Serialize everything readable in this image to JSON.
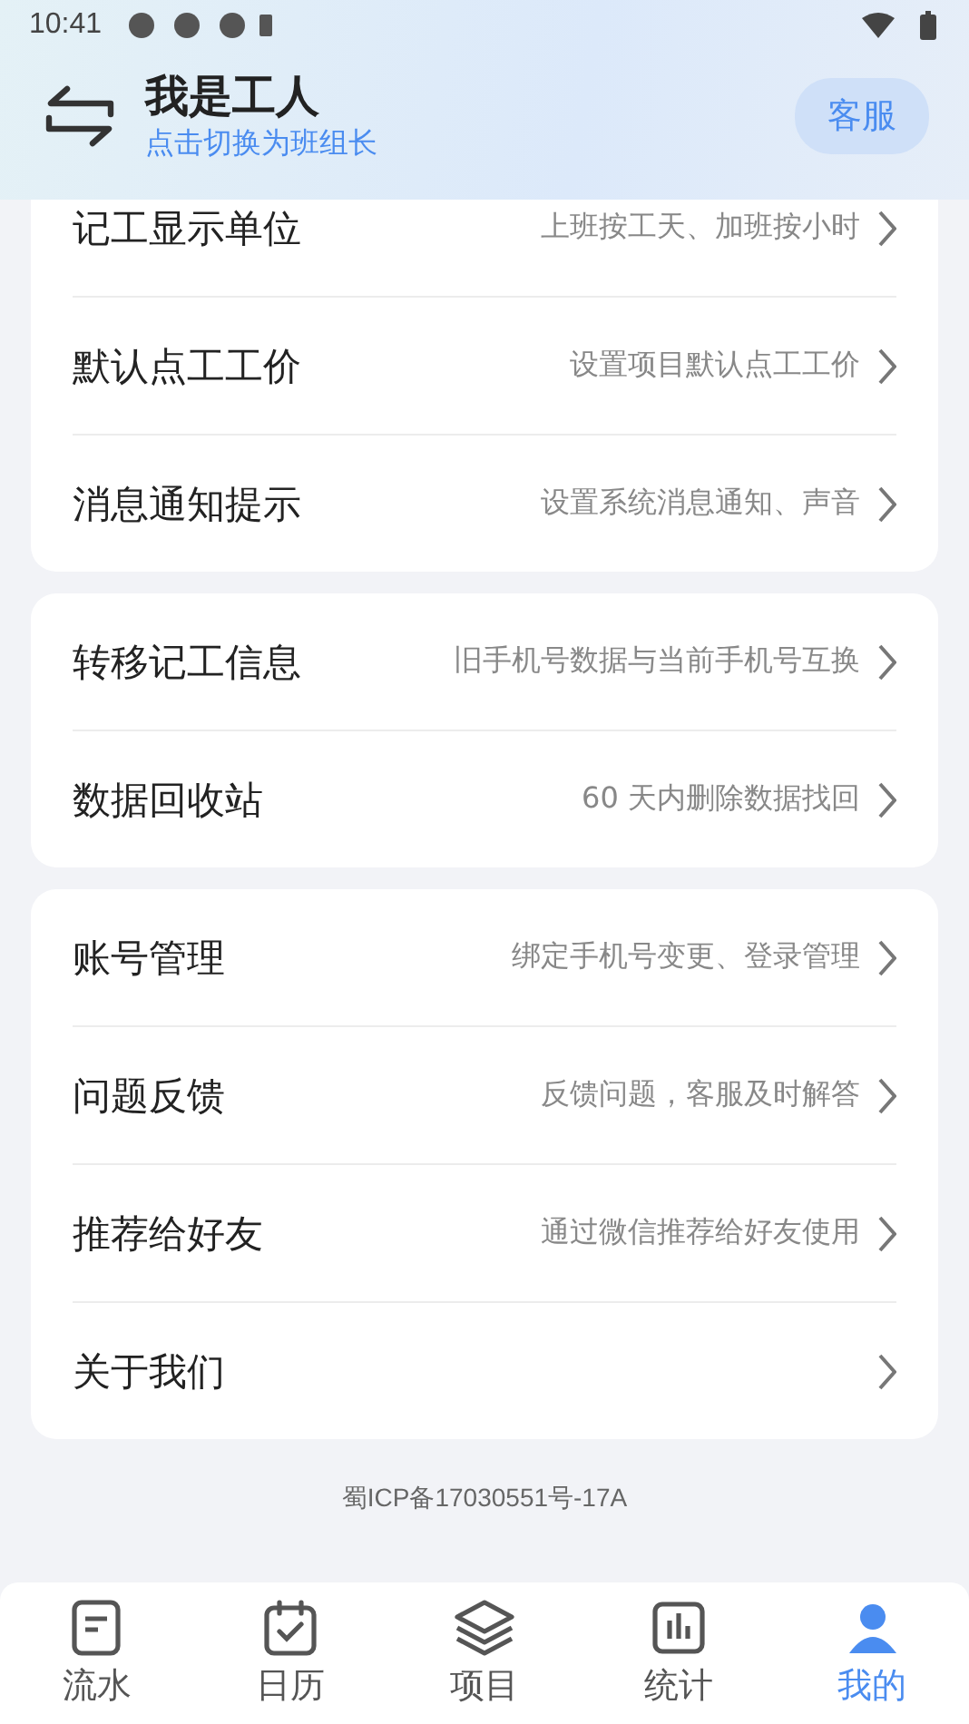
{
  "status_bar": {
    "time": "10:41"
  },
  "header": {
    "title": "我是工人",
    "subtitle": "点击切换为班组长",
    "service_button": "客服"
  },
  "groups": [
    {
      "rows": [
        {
          "label": "记工显示单位",
          "hint": "上班按工天、加班按小时"
        },
        {
          "label": "默认点工工价",
          "hint": "设置项目默认点工工价"
        },
        {
          "label": "消息通知提示",
          "hint": "设置系统消息通知、声音"
        }
      ]
    },
    {
      "rows": [
        {
          "label": "转移记工信息",
          "hint": "旧手机号数据与当前手机号互换"
        },
        {
          "label": "数据回收站",
          "hint": "60 天内删除数据找回"
        }
      ]
    },
    {
      "rows": [
        {
          "label": "账号管理",
          "hint": "绑定手机号变更、登录管理"
        },
        {
          "label": "问题反馈",
          "hint": "反馈问题，客服及时解答"
        },
        {
          "label": "推荐给好友",
          "hint": "通过微信推荐给好友使用"
        },
        {
          "label": "关于我们"
        }
      ]
    }
  ],
  "footer": "蜀ICP备17030551号-17A",
  "tab_bar": [
    {
      "label": "流水",
      "kind": "doc",
      "selected": false
    },
    {
      "label": "日历",
      "kind": "calendar",
      "selected": false
    },
    {
      "label": "项目",
      "kind": "layers",
      "selected": false
    },
    {
      "label": "统计",
      "kind": "chart",
      "selected": false
    },
    {
      "label": "我的",
      "kind": "person",
      "selected": true
    }
  ]
}
